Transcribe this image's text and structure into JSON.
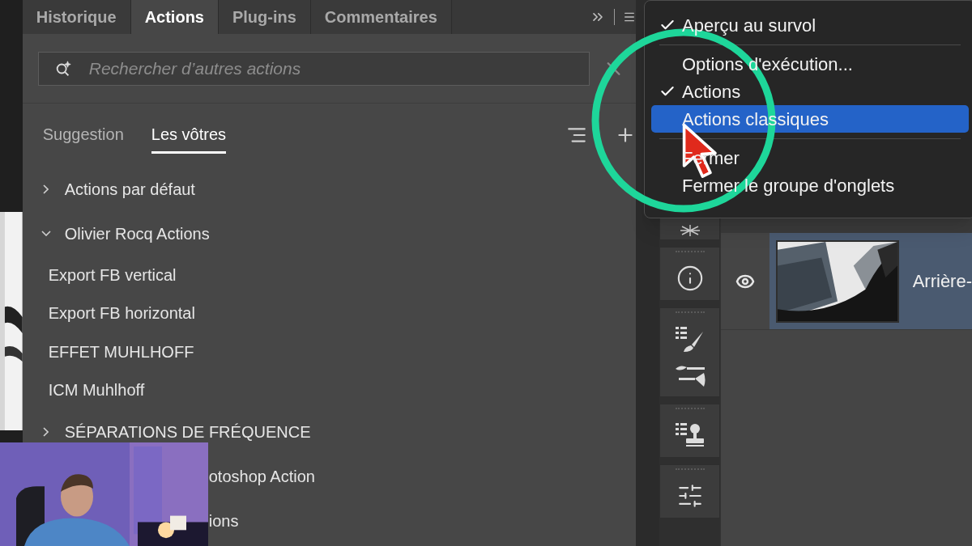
{
  "panel_tabs": [
    {
      "label": "Historique",
      "selected": false
    },
    {
      "label": "Actions",
      "selected": true
    },
    {
      "label": "Plug-ins",
      "selected": false
    },
    {
      "label": "Commentaires",
      "selected": false
    }
  ],
  "search": {
    "placeholder": "Rechercher d’autres actions"
  },
  "subtabs": [
    {
      "label": "Suggestion",
      "selected": false
    },
    {
      "label": "Les vôtres",
      "selected": true
    }
  ],
  "action_list": [
    {
      "label": "Actions par défaut",
      "kind": "group",
      "expanded": false
    },
    {
      "label": "Olivier Rocq Actions",
      "kind": "group",
      "expanded": true
    },
    {
      "label": "Export FB vertical",
      "kind": "action"
    },
    {
      "label": "Export FB horizontal",
      "kind": "action"
    },
    {
      "label": "EFFET MUHLHOFF",
      "kind": "action"
    },
    {
      "label": "ICM Muhlhoff",
      "kind": "action"
    },
    {
      "label": "SÉPARATIONS DE FRÉQUENCE",
      "kind": "group",
      "expanded": false
    },
    {
      "label": "otoshop Action",
      "kind": "partial"
    },
    {
      "label": "ions",
      "kind": "partial"
    }
  ],
  "panel_menu": [
    {
      "kind": "item",
      "label": "Aperçu au survol",
      "checked": true,
      "selected": false
    },
    {
      "kind": "separator"
    },
    {
      "kind": "item",
      "label": "Options d'exécution...",
      "checked": false,
      "selected": false
    },
    {
      "kind": "item",
      "label": "Actions",
      "checked": true,
      "selected": false
    },
    {
      "kind": "item",
      "label": "Actions classiques",
      "checked": false,
      "selected": true
    },
    {
      "kind": "separator"
    },
    {
      "kind": "item",
      "label": "Fermer",
      "checked": false,
      "selected": false
    },
    {
      "kind": "item",
      "label": "Fermer le groupe d'onglets",
      "checked": false,
      "selected": false
    }
  ],
  "layers": [
    {
      "name": "Arrière-",
      "visible": true,
      "selected": true
    }
  ]
}
